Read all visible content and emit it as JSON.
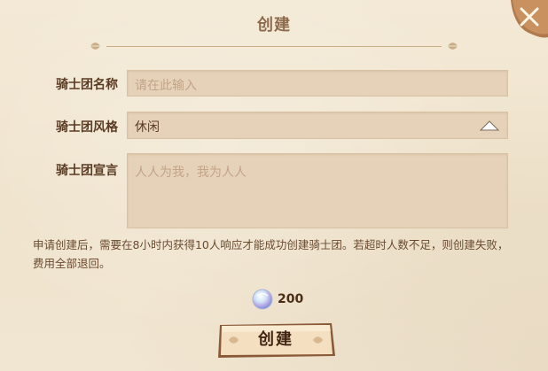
{
  "dialog": {
    "title": "创建",
    "close_icon": "close-x-icon"
  },
  "form": {
    "name": {
      "label": "骑士团名称",
      "placeholder": "请在此输入",
      "value": ""
    },
    "style": {
      "label": "骑士团风格",
      "value": "休闲",
      "arrow_icon": "triangle-up-icon"
    },
    "declaration": {
      "label": "骑士团宣言",
      "placeholder": "人人为我，我为人人",
      "value": ""
    }
  },
  "notice": "申请创建后，需要在8小时内获得10人响应才能成功创建骑士团。若超时人数不足，则创建失败，费用全部退回。",
  "cost": {
    "icon": "crystal-gem-icon",
    "amount": "200"
  },
  "create_button": {
    "label": "创建"
  },
  "colors": {
    "background": "#efe4cf",
    "field": "#e6d2b8",
    "label": "#5a3b23",
    "placeholder": "#c2a488",
    "button": "#f4dfc0",
    "close_button": "#b0794e"
  }
}
